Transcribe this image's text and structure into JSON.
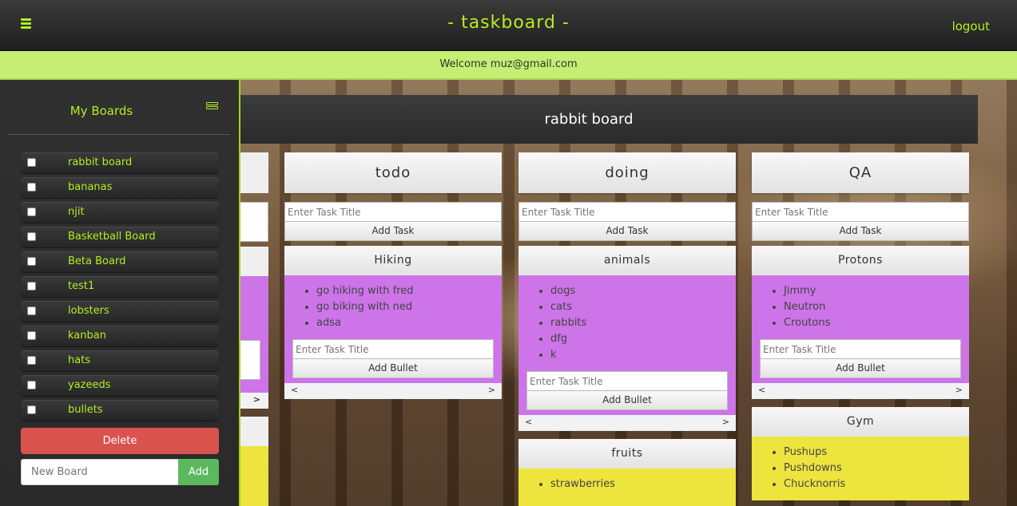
{
  "header": {
    "title": "- taskboard -",
    "logout_label": "logout",
    "welcome": "Welcome muz@gmail.com"
  },
  "sidebar": {
    "title": "My Boards",
    "boards": [
      {
        "label": "rabbit board",
        "checked": false
      },
      {
        "label": "bananas",
        "checked": false
      },
      {
        "label": "njit",
        "checked": false
      },
      {
        "label": "Basketball Board",
        "checked": false
      },
      {
        "label": "Beta Board",
        "checked": false
      },
      {
        "label": "test1",
        "checked": false
      },
      {
        "label": "lobsters",
        "checked": false
      },
      {
        "label": "kanban",
        "checked": false
      },
      {
        "label": "hats",
        "checked": false
      },
      {
        "label": "yazeeds",
        "checked": false
      },
      {
        "label": "bullets",
        "checked": false
      }
    ],
    "delete_label": "Delete",
    "new_board_placeholder": "New Board",
    "add_label": "Add"
  },
  "board": {
    "title": "rabbit board",
    "task_placeholder": "Enter Task Title",
    "add_task_label": "Add Task",
    "add_bullet_label": "Add Bullet",
    "prev_glyph": "<",
    "next_glyph": ">",
    "columns": [
      {
        "title": "todo",
        "cards": [
          {
            "title": "Hiking",
            "color": "#cd74e8",
            "bullets": [
              "go hiking with fred",
              "go biking with ned",
              "adsa"
            ]
          }
        ]
      },
      {
        "title": "doing",
        "cards": [
          {
            "title": "animals",
            "color": "#cd74e8",
            "bullets": [
              "dogs",
              "cats",
              "rabbits",
              "dfg",
              "k"
            ]
          },
          {
            "title": "fruits",
            "color": "#ede43d",
            "bullets": [
              "strawberries"
            ]
          }
        ]
      },
      {
        "title": "QA",
        "cards": [
          {
            "title": "Protons",
            "color": "#cd74e8",
            "bullets": [
              "Jimmy",
              "Neutron",
              "Croutons"
            ]
          },
          {
            "title": "Gym",
            "color": "#ede43d",
            "bullets": [
              "Pushups",
              "Pushdowns",
              "Chucknorris"
            ]
          }
        ]
      }
    ]
  },
  "colors": {
    "accent": "#b4ee1f",
    "welcome_bg": "#c5ee73",
    "delete": "#d9534f",
    "add": "#5cb85c",
    "card_purple": "#cd74e8",
    "card_yellow": "#ede43d"
  }
}
